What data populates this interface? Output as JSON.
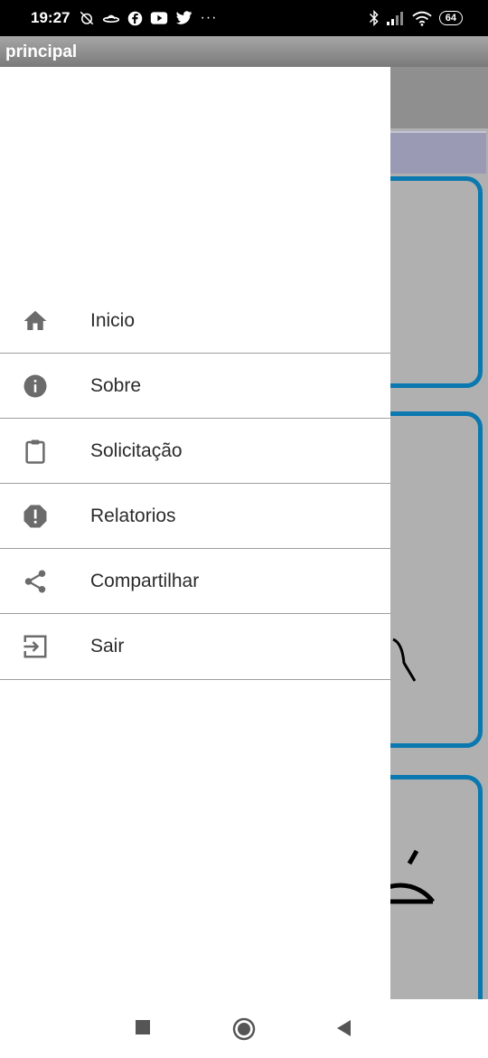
{
  "status_bar": {
    "time": "19:27",
    "notification_icons": [
      "alarm-off-icon",
      "ufo-icon",
      "facebook-icon",
      "youtube-icon",
      "twitter-icon",
      "more-icon"
    ],
    "more_label": "···",
    "battery_level": "64"
  },
  "app_bar": {
    "title": "principal"
  },
  "drawer": {
    "items": [
      {
        "label": "Inicio",
        "icon": "home-icon"
      },
      {
        "label": "Sobre",
        "icon": "info-icon"
      },
      {
        "label": "Solicitação",
        "icon": "clipboard-icon"
      },
      {
        "label": "Relatorios",
        "icon": "report-icon"
      },
      {
        "label": "Compartilhar",
        "icon": "share-icon"
      },
      {
        "label": "Sair",
        "icon": "exit-icon"
      }
    ]
  },
  "nav_bar": {
    "buttons": [
      "recents-button",
      "home-button",
      "back-button"
    ]
  },
  "colors": {
    "card_border": "#0b78b0",
    "status_bar": "#000000",
    "app_bar": "#8a8a8a",
    "icon_gray": "#6b6b6b"
  }
}
